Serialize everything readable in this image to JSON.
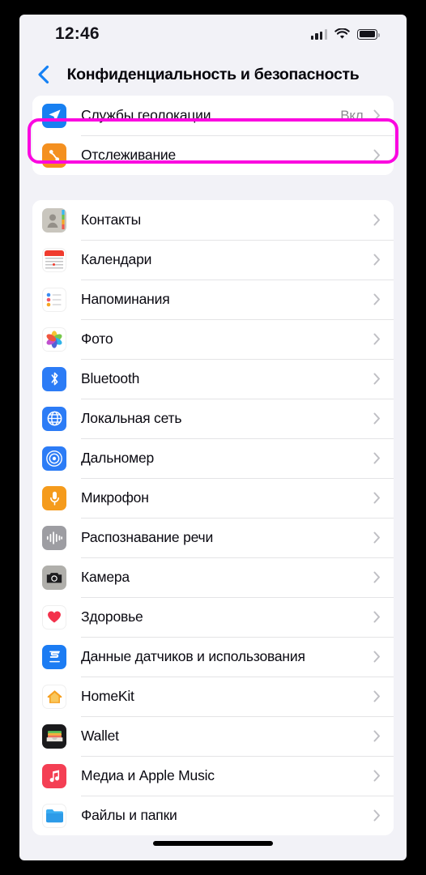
{
  "status_bar": {
    "time": "12:46",
    "signal_icon": "cellular-signal-icon",
    "wifi_icon": "wifi-icon",
    "battery_icon": "battery-icon"
  },
  "nav": {
    "back_icon": "back-chevron-icon",
    "title": "Конфиденциальность и безопасность"
  },
  "highlight": {
    "color": "#FB07E0",
    "target": "Службы геолокации"
  },
  "groups": [
    {
      "id": "group-primary",
      "rows": [
        {
          "label": "Службы геолокации",
          "value": "Вкл.",
          "icon": "location-services-icon",
          "icon_class": "ic-loc",
          "highlighted": true
        },
        {
          "label": "Отслеживание",
          "value": "",
          "icon": "tracking-icon",
          "icon_class": "ic-track",
          "highlighted": false
        }
      ]
    },
    {
      "id": "group-app-permissions",
      "rows": [
        {
          "label": "Контакты",
          "value": "",
          "icon": "contacts-icon",
          "icon_class": "ic-contacts",
          "highlighted": false
        },
        {
          "label": "Календари",
          "value": "",
          "icon": "calendar-icon",
          "icon_class": "ic-cal",
          "highlighted": false
        },
        {
          "label": "Напоминания",
          "value": "",
          "icon": "reminders-icon",
          "icon_class": "ic-rem",
          "highlighted": false
        },
        {
          "label": "Фото",
          "value": "",
          "icon": "photos-icon",
          "icon_class": "ic-photos",
          "highlighted": false
        },
        {
          "label": "Bluetooth",
          "value": "",
          "icon": "bluetooth-icon",
          "icon_class": "ic-bt",
          "highlighted": false
        },
        {
          "label": "Локальная сеть",
          "value": "",
          "icon": "local-network-icon",
          "icon_class": "ic-net",
          "highlighted": false
        },
        {
          "label": "Дальномер",
          "value": "",
          "icon": "rangefinder-icon",
          "icon_class": "ic-range",
          "highlighted": false
        },
        {
          "label": "Микрофон",
          "value": "",
          "icon": "microphone-icon",
          "icon_class": "ic-mic",
          "highlighted": false
        },
        {
          "label": "Распознавание речи",
          "value": "",
          "icon": "speech-recognition-icon",
          "icon_class": "ic-speech",
          "highlighted": false
        },
        {
          "label": "Камера",
          "value": "",
          "icon": "camera-icon",
          "icon_class": "ic-cam",
          "highlighted": false
        },
        {
          "label": "Здоровье",
          "value": "",
          "icon": "health-icon",
          "icon_class": "ic-health",
          "highlighted": false
        },
        {
          "label": "Данные датчиков и использования",
          "value": "",
          "icon": "sensor-data-icon",
          "icon_class": "ic-sensor",
          "highlighted": false
        },
        {
          "label": "HomeKit",
          "value": "",
          "icon": "homekit-icon",
          "icon_class": "ic-home",
          "highlighted": false
        },
        {
          "label": "Wallet",
          "value": "",
          "icon": "wallet-icon",
          "icon_class": "ic-wallet",
          "highlighted": false
        },
        {
          "label": "Медиа и Apple Music",
          "value": "",
          "icon": "apple-music-icon",
          "icon_class": "ic-music",
          "highlighted": false
        },
        {
          "label": "Файлы и папки",
          "value": "",
          "icon": "files-icon",
          "icon_class": "ic-files",
          "highlighted": false
        }
      ]
    }
  ]
}
